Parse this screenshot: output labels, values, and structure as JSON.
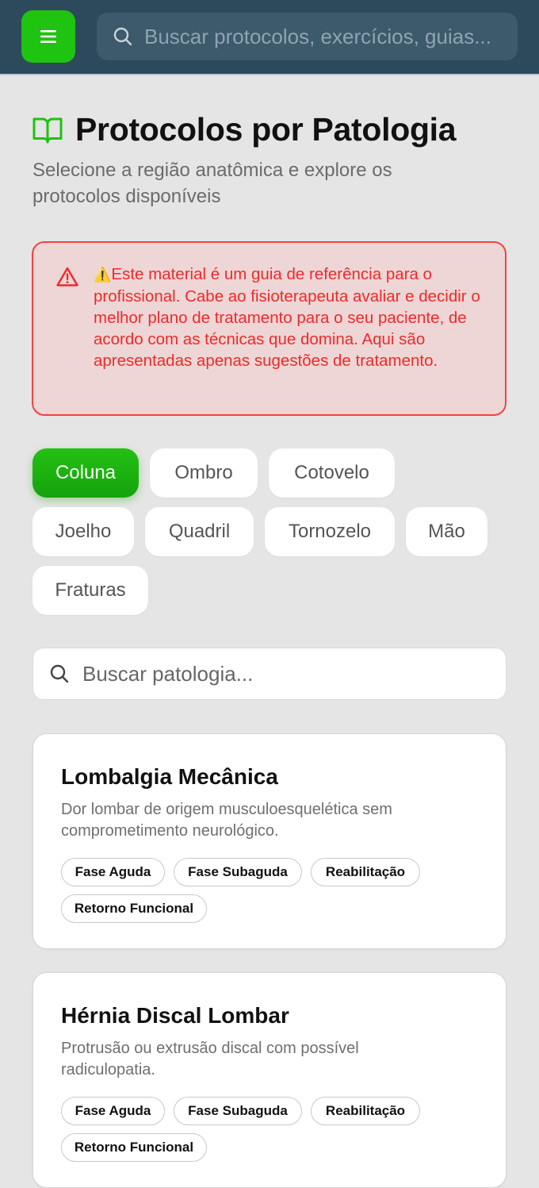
{
  "header": {
    "menu_icon": "hamburger-menu-icon",
    "search_placeholder": "Buscar protocolos, exercícios, guias...",
    "search_icon": "search-icon",
    "accent_color": "#1ec40f",
    "bar_color": "#2d4a5d"
  },
  "page": {
    "title_icon": "open-book-icon",
    "title": "Protocolos por Patologia",
    "subtitle": "Selecione a região anatômica e explore os protocolos disponíveis"
  },
  "warning": {
    "icon": "warning-triangle-icon",
    "emoji": "⚠️",
    "text": "Este material é um guia de referência para o profissional. Cabe ao fisioterapeuta avaliar e decidir o melhor plano de tratamento para o seu paciente, de acordo com as técnicas que domina. Aqui são apresentadas apenas sugestões de tratamento.",
    "color": "#ef2a2a"
  },
  "regions": {
    "selected": "Coluna",
    "items": [
      "Coluna",
      "Ombro",
      "Cotovelo",
      "Joelho",
      "Quadril",
      "Tornozelo",
      "Mão",
      "Fraturas"
    ]
  },
  "pathology_search": {
    "placeholder": "Buscar patologia...",
    "icon": "search-icon"
  },
  "cards": [
    {
      "title": "Lombalgia Mecânica",
      "description": "Dor lombar de origem musculoesquelética sem comprometimento neurológico.",
      "tags": [
        "Fase Aguda",
        "Fase Subaguda",
        "Reabilitação",
        "Retorno Funcional"
      ]
    },
    {
      "title": "Hérnia Discal Lombar",
      "description": "Protrusão ou extrusão discal com possível radiculopatia.",
      "tags": [
        "Fase Aguda",
        "Fase Subaguda",
        "Reabilitação",
        "Retorno Funcional"
      ]
    }
  ]
}
